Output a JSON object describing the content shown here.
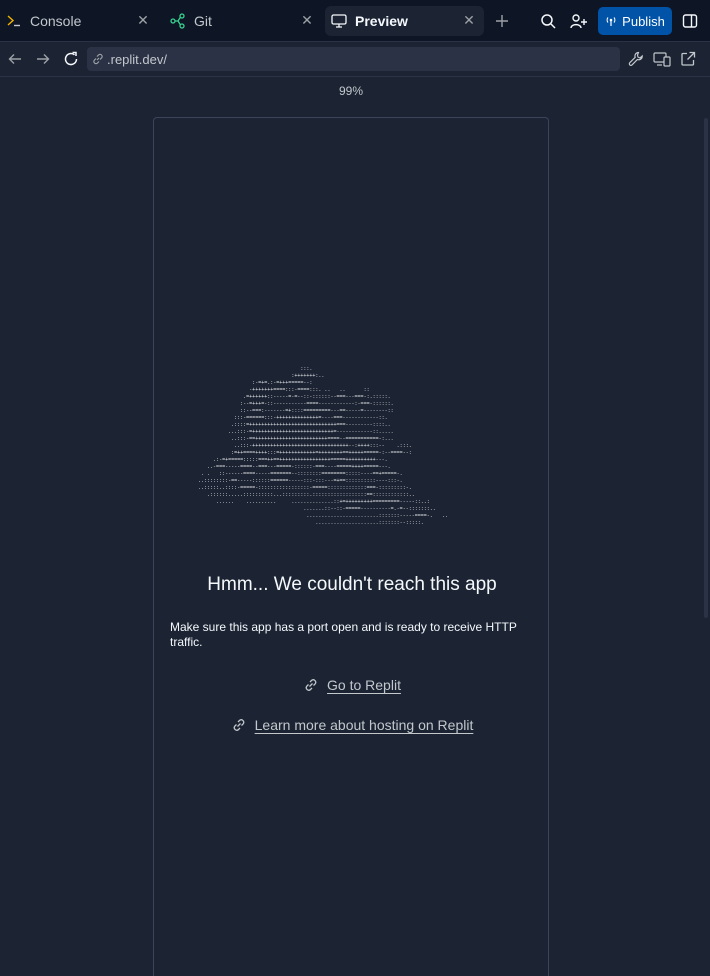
{
  "tabs": [
    {
      "label": "Console",
      "icon": "terminal-icon",
      "active": false
    },
    {
      "label": "Git",
      "icon": "git-branch-icon",
      "active": false
    },
    {
      "label": "Preview",
      "icon": "monitor-icon",
      "active": true
    }
  ],
  "toolbar": {
    "publish_label": "Publish",
    "accent_color": "#0053a6"
  },
  "address": {
    "url": ".replit.dev/"
  },
  "viewport": {
    "zoom": "99%"
  },
  "error_page": {
    "title": "Hmm... We couldn't reach this app",
    "description": "Make sure this app has a port open and is ready to receive HTTP traffic.",
    "links": [
      {
        "label": "Go to Replit",
        "icon": "link-icon"
      },
      {
        "label": "Learn more about hosting on Replit",
        "icon": "link-icon"
      }
    ]
  },
  "colors": {
    "background": "#1c2333",
    "tabbar": "#0e1525",
    "text": "#f5f9fc"
  }
}
